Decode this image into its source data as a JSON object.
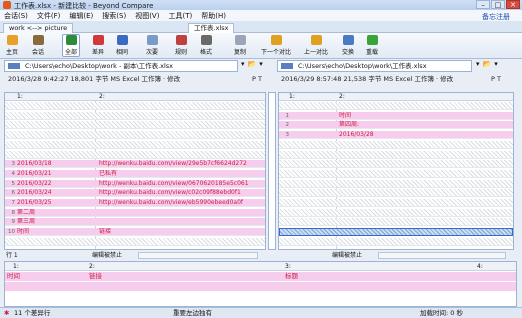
{
  "window": {
    "title": "工作表.xlsx - 新建比较 - Beyond Compare",
    "buttons": [
      "–",
      "□",
      "✕"
    ]
  },
  "menu": {
    "items": [
      "会话(S)",
      "文件(F)",
      "编辑(E)",
      "搜索(S)",
      "视图(V)",
      "工具(T)",
      "帮助(H)"
    ],
    "right_link": "备忘注册"
  },
  "tabs": [
    {
      "label": "work <--> picture"
    },
    {
      "label": "工作表.xlsx"
    }
  ],
  "toolbar": {
    "buttons": [
      {
        "label": "主页",
        "icon": "home-icon",
        "color": "#e8a02a"
      },
      {
        "label": "会话",
        "icon": "session-icon",
        "color": "#8a6a3a"
      },
      {
        "label": "全部",
        "icon": "all-icon",
        "color": "#2e8b3a"
      },
      {
        "label": "差异",
        "icon": "diff-icon",
        "color": "#d23a3a"
      },
      {
        "label": "相同",
        "icon": "same-icon",
        "color": "#3a6ac4"
      },
      {
        "label": "次要",
        "icon": "minor-icon",
        "color": "#7a9ac9"
      },
      {
        "label": "规则",
        "icon": "rules-icon",
        "color": "#c04040"
      },
      {
        "label": "格式",
        "icon": "format-icon",
        "color": "#6a6a6a"
      },
      {
        "label": "复制",
        "icon": "copy-icon",
        "color": "#9aa6b8"
      },
      {
        "label": "下一个对比",
        "icon": "next-diff-icon",
        "color": "#e0a020"
      },
      {
        "label": "上一对比",
        "icon": "prev-diff-icon",
        "color": "#e0a020"
      },
      {
        "label": "交换",
        "icon": "swap-icon",
        "color": "#4a7ac4"
      },
      {
        "label": "重载",
        "icon": "reload-icon",
        "color": "#3aa33a"
      }
    ]
  },
  "left": {
    "path": "C:\\Users\\echo\\Desktop\\work - 副本\\工作表.xlsx",
    "info": "2016/3/28 9:42:27    18,801 字节    MS Excel 工作簿 · 修改",
    "info_extra": "P  T",
    "col_headers": [
      "1:",
      "2:"
    ],
    "rows": [
      {
        "n": "",
        "c1": "",
        "c2": "",
        "style": "hatch"
      },
      {
        "n": "",
        "c1": "",
        "c2": "",
        "style": "hatch"
      },
      {
        "n": "",
        "c1": "",
        "c2": "",
        "style": "hatch"
      },
      {
        "n": "",
        "c1": "",
        "c2": "",
        "style": "hatch"
      },
      {
        "n": "",
        "c1": "",
        "c2": "",
        "style": "hatch"
      },
      {
        "n": "",
        "c1": "",
        "c2": "",
        "style": "hatch"
      },
      {
        "n": "3",
        "c1": "2016/03/18",
        "c2": "http://wenku.baidu.com/view/29e5b7cf6624d272",
        "style": "pink"
      },
      {
        "n": "4",
        "c1": "2016/03/21",
        "c2": "已私有",
        "style": "pink"
      },
      {
        "n": "5",
        "c1": "2016/03/22",
        "c2": "http://wenku.baidu.com/view/0670620185e5c061",
        "style": "pink"
      },
      {
        "n": "6",
        "c1": "2016/03/24",
        "c2": "http://wenku.baidu.com/view/c02c09f88ebd0f1",
        "style": "pink"
      },
      {
        "n": "7",
        "c1": "2016/03/25",
        "c2": "http://wenku.baidu.com/view/eb5990ebeed0a0f",
        "style": "pink"
      },
      {
        "n": "8",
        "c1": "第二周",
        "c2": "",
        "style": "pink"
      },
      {
        "n": "9",
        "c1": "第三周",
        "c2": "",
        "style": "pink"
      },
      {
        "n": "10",
        "c1": "时间",
        "c2": "链接",
        "style": "pink"
      },
      {
        "n": "",
        "c1": "",
        "c2": "",
        "style": "hatch"
      }
    ],
    "scroll": {
      "row_label": "行 1",
      "edit": "编辑被禁止"
    }
  },
  "right": {
    "path": "C:\\Users\\echo\\Desktop\\work\\工作表.xlsx",
    "info": "2016/3/29 8:57:48    21,538 字节    MS Excel 工作簿 · 修改",
    "info_extra": "P  T",
    "col_headers": [
      "1:",
      "2:"
    ],
    "rows": [
      {
        "n": "",
        "c1": "",
        "c2": "",
        "style": "hatch"
      },
      {
        "n": "1",
        "c1": "",
        "c2": "时间",
        "style": "pink"
      },
      {
        "n": "2",
        "c1": "",
        "c2": "第四周:",
        "style": "pink"
      },
      {
        "n": "3",
        "c1": "",
        "c2": "2016/03/28",
        "style": "pink"
      },
      {
        "n": "",
        "c1": "",
        "c2": "",
        "style": "hatch"
      },
      {
        "n": "",
        "c1": "",
        "c2": "",
        "style": "hatch"
      },
      {
        "n": "",
        "c1": "",
        "c2": "",
        "style": "hatch"
      },
      {
        "n": "",
        "c1": "",
        "c2": "",
        "style": "hatch"
      },
      {
        "n": "",
        "c1": "",
        "c2": "",
        "style": "hatch"
      },
      {
        "n": "",
        "c1": "",
        "c2": "",
        "style": "hatch"
      },
      {
        "n": "",
        "c1": "",
        "c2": "",
        "style": "hatch"
      },
      {
        "n": "",
        "c1": "",
        "c2": "",
        "style": "hatch"
      },
      {
        "n": "",
        "c1": "",
        "c2": "",
        "style": "hatch"
      },
      {
        "n": "",
        "c1": "",
        "c2": "",
        "style": "selected"
      },
      {
        "n": "",
        "c1": "",
        "c2": "",
        "style": "hatch"
      }
    ],
    "scroll": {
      "edit": "编辑被禁止"
    }
  },
  "bottom": {
    "col_headers": [
      "1:",
      "2:",
      "3:",
      "4:"
    ],
    "row_values": [
      "时间",
      "链接",
      "标题",
      ""
    ]
  },
  "status": {
    "diff_count": "11 个差异行",
    "mode": "重要左边独有",
    "load_time": "加载时间: 0 秒"
  }
}
